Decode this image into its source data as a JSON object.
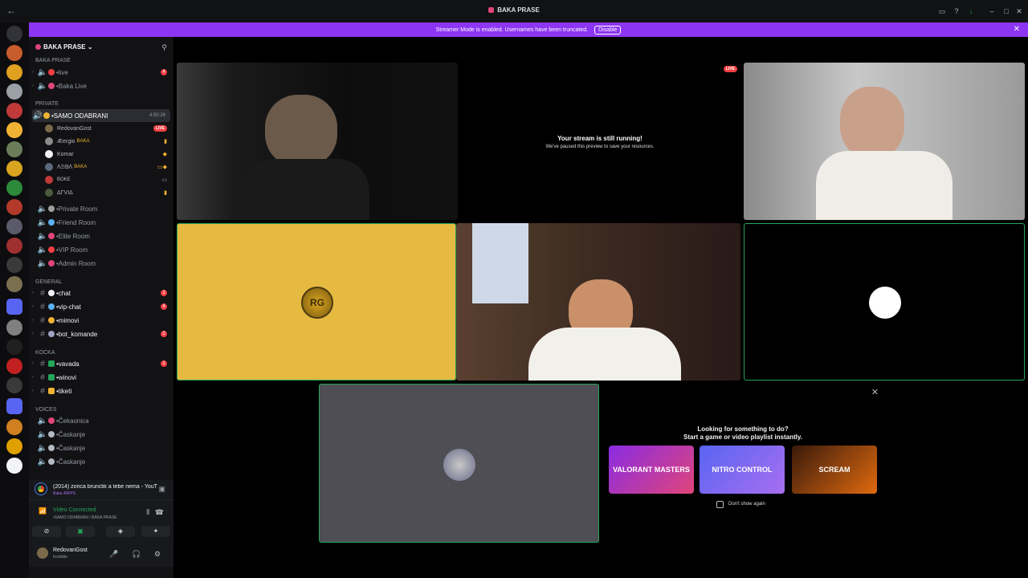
{
  "window": {
    "title": "BAKA PRASE"
  },
  "banner": {
    "text": "Streamer Mode is enabled. Usernames have been truncated.",
    "disable_label": "Disable"
  },
  "guild": {
    "name": "BAKA PRASE"
  },
  "categories": {
    "baka": "BAKA PRASE",
    "private": "PRIVATE",
    "general": "GENERAL",
    "kocka": "KOCKA",
    "voices": "VOICES"
  },
  "channels": {
    "live": "•live",
    "live_count": "4",
    "baka_live": "•Baka Live",
    "samo": "•SAMO ODABRANI",
    "samo_timer": "4:50:26",
    "private_room": "•Private Room",
    "friend_room": "•Friend Room",
    "elite_room": "•Elite Room",
    "vip_room": "•VIP Room",
    "admin_room": "•Admin Room",
    "chat": "•chat",
    "chat_count": "2",
    "vip_chat": "•vip-chat",
    "vip_chat_count": "4",
    "mimovi": "•mimovi",
    "bot": "•bot_komande",
    "bot_count": "2",
    "vavada": "•vavada",
    "vavada_count": "1",
    "winovi": "•winovi",
    "tiketi": "•tiketi",
    "cekaonica": "•Čekaonica",
    "caskanje": "•Časkanje"
  },
  "voice_users": [
    {
      "name": "RedovanGost",
      "live": "LIVE"
    },
    {
      "name": "Æergio",
      "tag": "BAKA"
    },
    {
      "name": "Komar"
    },
    {
      "name": "ΛΞΘΛ",
      "tag": "BAKA"
    },
    {
      "name": "BOKE"
    },
    {
      "name": "ΔΓVΙΔ"
    }
  ],
  "now_playing": {
    "title": "(2014) zorica brunclik a tebe nema - YouTub...",
    "sub": "Baka 40FPS"
  },
  "voice": {
    "status": "Video Connected",
    "location": "•SAMO ODABRANI / BAKA PRASE"
  },
  "user": {
    "name": "RedovanGost",
    "status": "Invisible"
  },
  "stream": {
    "live": "LIVE",
    "headline": "Your stream is still running!",
    "sub": "We've paused this preview to save your resources."
  },
  "activity": {
    "line1": "Looking for something to do?",
    "line2": "Start a game or video playlist instantly.",
    "cards": [
      "VALORANT MASTERS",
      "NITRO CONTROL",
      "SCREAM"
    ],
    "dont_show": "Don't show again"
  },
  "colors": {
    "banner": "#8c35f2",
    "live_red": "#f23f43",
    "connected_green": "#23a55a",
    "yellow_tile": "#e6b941"
  }
}
